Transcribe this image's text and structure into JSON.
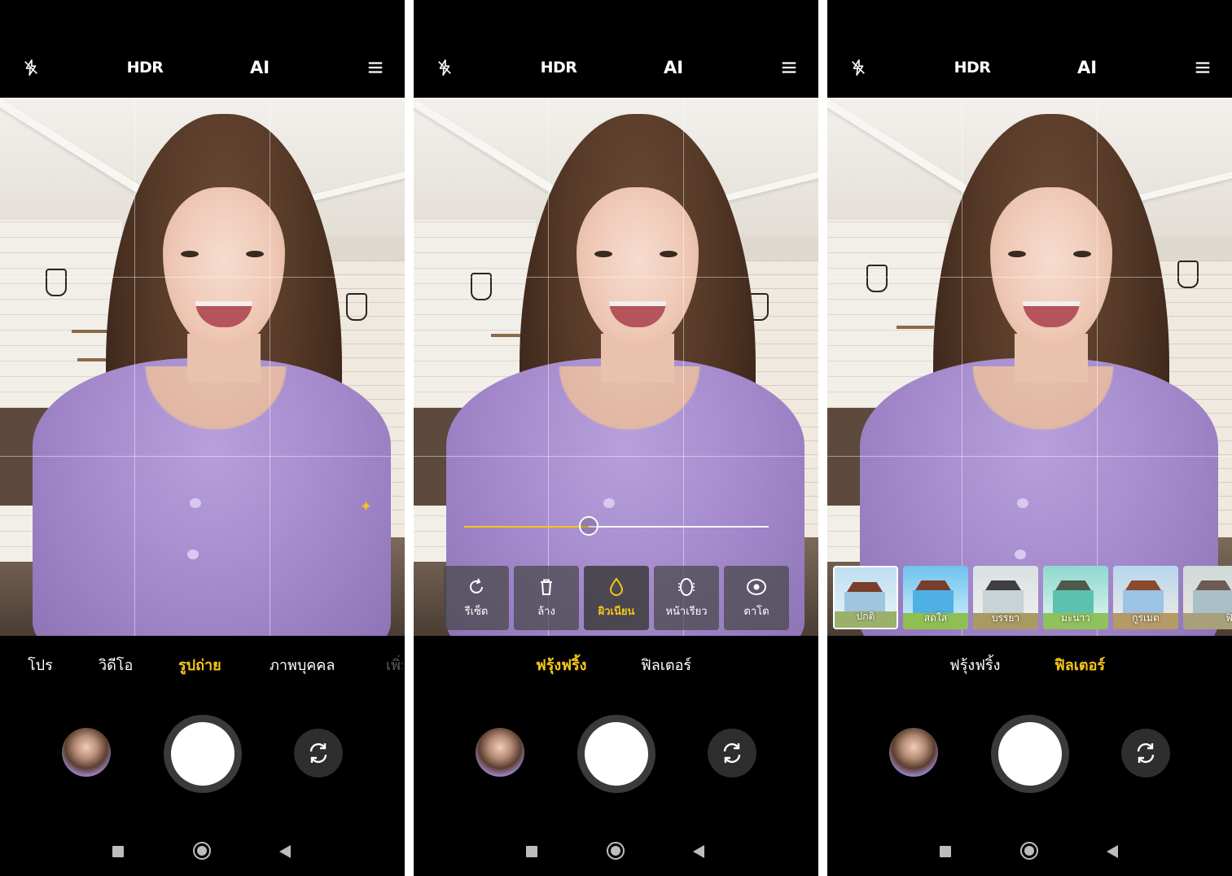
{
  "topbar": {
    "flash_icon": "flash-off-icon",
    "hdr_label": "HDR",
    "ai_label": "AI",
    "menu_icon": "menu-icon"
  },
  "panel1": {
    "modes": [
      "โปร",
      "วิดีโอ",
      "รูปถ่าย",
      "ภาพบุคคล",
      "เพิ่ม"
    ],
    "active_mode": "รูปถ่าย"
  },
  "panel2": {
    "slider_value": 0.41,
    "tools": [
      {
        "label": "รีเซ็ต",
        "icon": "reset-icon"
      },
      {
        "label": "ล้าง",
        "icon": "trash-icon"
      },
      {
        "label": "ผิวเนียน",
        "icon": "drop-icon"
      },
      {
        "label": "หน้าเรียว",
        "icon": "face-slim-icon"
      },
      {
        "label": "ตาโต",
        "icon": "eye-icon"
      }
    ],
    "active_tool": "ผิวเนียน",
    "tabs": [
      "ฟรุ้งฟริ้ง",
      "ฟิลเตอร์"
    ],
    "active_tab": "ฟรุ้งฟริ้ง"
  },
  "panel3": {
    "filters": [
      "ปกติ",
      "สดใส",
      "บรรยา",
      "มะนาว",
      "กูรเมต",
      "ฟิล์ม"
    ],
    "active_filter": "ปกติ",
    "tabs": [
      "ฟรุ้งฟริ้ง",
      "ฟิลเตอร์"
    ],
    "active_tab": "ฟิลเตอร์"
  },
  "colors": {
    "accent": "#f5c518",
    "background": "#000000",
    "shirt": "#a48acc"
  }
}
